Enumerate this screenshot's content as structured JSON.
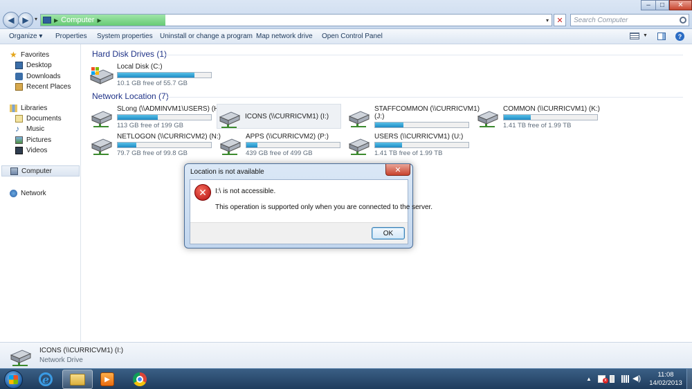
{
  "window": {
    "address": {
      "location": "Computer"
    },
    "search_placeholder": "Search Computer",
    "controls": {
      "minimize": "–",
      "maximize": "□",
      "close": "✕"
    }
  },
  "toolbar": {
    "organize": "Organize ▾",
    "properties": "Properties",
    "system_properties": "System properties",
    "uninstall": "Uninstall or change a program",
    "map_drive": "Map network drive",
    "control_panel": "Open Control Panel"
  },
  "nav": {
    "favorites": "Favorites",
    "desktop": "Desktop",
    "downloads": "Downloads",
    "recent": "Recent Places",
    "libraries": "Libraries",
    "documents": "Documents",
    "music": "Music",
    "pictures": "Pictures",
    "videos": "Videos",
    "computer": "Computer",
    "network": "Network"
  },
  "groups": {
    "hard_disk": "Hard Disk Drives (1)",
    "network": "Network Location (7)"
  },
  "drives": {
    "local_c": {
      "name": "Local Disk (C:)",
      "space": "10.1 GB free of 55.7 GB",
      "used_fraction": 0.82
    },
    "slong_h": {
      "name": "SLong (\\\\ADMINVM1\\USERS) (H:)",
      "space": "113 GB free of 199 GB",
      "used_fraction": 0.43
    },
    "icons_i": {
      "name": "ICONS (\\\\CURRICVM1) (I:)"
    },
    "staffcommon_j": {
      "name": "STAFFCOMMON (\\\\CURRICVM1)",
      "sub": "(J:)",
      "used_fraction": 0.3
    },
    "common_k": {
      "name": "COMMON (\\\\CURRICVM1) (K:)",
      "space": "1.41 TB free of 1.99 TB",
      "used_fraction": 0.29
    },
    "netlogon_n": {
      "name": "NETLOGON (\\\\CURRICVM2) (N:)",
      "space": "79.7 GB free of 99.8 GB",
      "used_fraction": 0.2
    },
    "apps_p": {
      "name": "APPS (\\\\CURRICVM2) (P:)",
      "space": "439 GB free of 499 GB",
      "used_fraction": 0.12
    },
    "users_u": {
      "name": "USERS (\\\\CURRICVM1) (U:)",
      "space": "1.41 TB free of 1.99 TB",
      "used_fraction": 0.29
    }
  },
  "details": {
    "name": "ICONS (\\\\CURRICVM1) (I:)",
    "type": "Network Drive"
  },
  "dialog": {
    "title": "Location is not available",
    "close": "✕",
    "message1": "I:\\ is not accessible.",
    "message2": "This operation is supported only when you are connected to the server.",
    "ok": "OK"
  },
  "taskbar": {
    "time": "11:08",
    "date": "14/02/2013",
    "ie_glyph": "e",
    "media_glyph": "▶",
    "vol_glyph": "◀)"
  }
}
